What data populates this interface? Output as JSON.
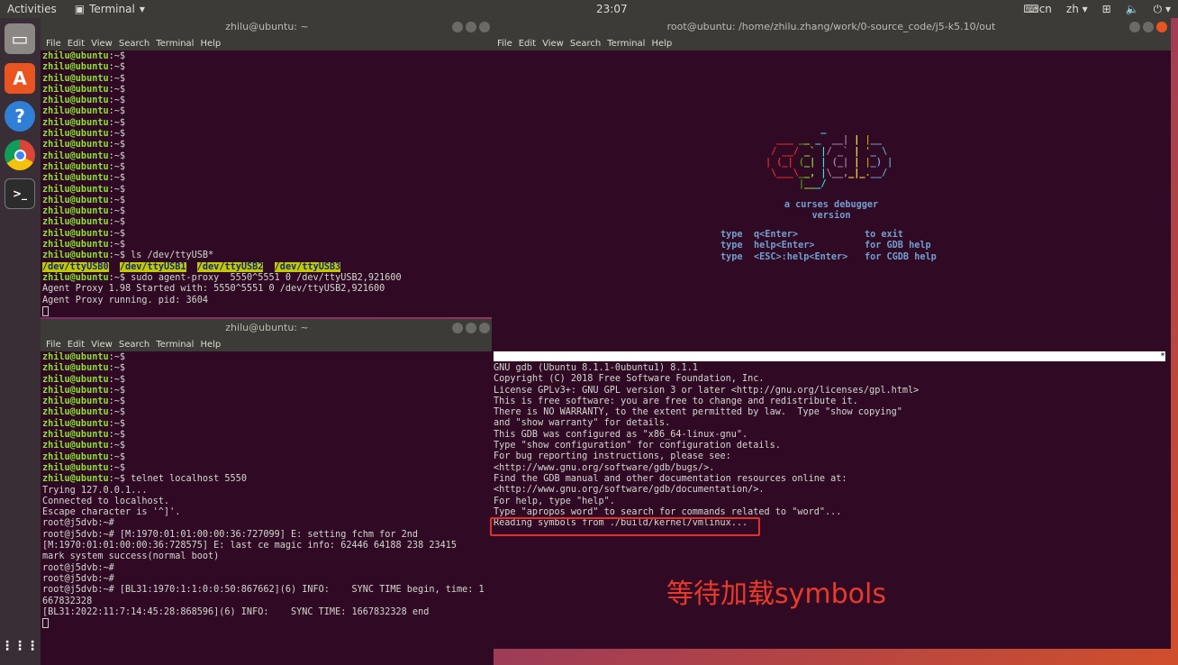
{
  "topbar": {
    "activities": "Activities",
    "app": "Terminal",
    "clock": "23:07",
    "kbd": "cn",
    "lang": "zh"
  },
  "dock": {
    "items": [
      "files",
      "software",
      "help",
      "chrome",
      "terminal"
    ],
    "apps_grid": "show-applications"
  },
  "term1": {
    "title": "zhilu@ubuntu: ~",
    "menu": [
      "File",
      "Edit",
      "View",
      "Search",
      "Terminal",
      "Help"
    ],
    "prompt_user": "zhilu@ubuntu",
    "prompt_rest": ":~$",
    "empty_prompts": 18,
    "cmd1": " ls /dev/ttyUSB*",
    "devs": [
      "/dev/ttyUSB0",
      "/dev/ttyUSB1",
      "/dev/ttyUSB2",
      "/dev/ttyUSB3"
    ],
    "cmd2": " sudo agent-proxy  5550^5551 0 /dev/ttyUSB2,921600",
    "out": [
      "Agent Proxy 1.98 Started with: 5550^5551 0 /dev/ttyUSB2,921600",
      "Agent Proxy running. pid: 3604"
    ]
  },
  "term2": {
    "title": "zhilu@ubuntu: ~",
    "menu": [
      "File",
      "Edit",
      "View",
      "Search",
      "Terminal",
      "Help"
    ],
    "empty_prompts": 11,
    "cmd": " telnet localhost 5550",
    "out": [
      "Trying 127.0.0.1...",
      "Connected to localhost.",
      "Escape character is '^]'.",
      "",
      "root@j5dvb:~#",
      "root@j5dvb:~# [M:1970:01:01:00:00:36:727099] E: setting fchm for 2nd",
      "[M:1970:01:01:00:00:36:728575] E: last ce magic info: 62446 64188 238 23415",
      "mark system success(normal boot)",
      "",
      "root@j5dvb:~#",
      "root@j5dvb:~#",
      "root@j5dvb:~# [BL31:1970:1:1:0:0:50:867662](6) INFO:    SYNC TIME begin, time: 1",
      "667832328",
      "[BL31:2022:11:7:14:45:28:868596](6) INFO:    SYNC TIME: 1667832328 end"
    ]
  },
  "term3": {
    "title": "root@ubuntu: /home/zhilu.zhang/work/0-source_code/j5-k5.10/out",
    "menu": [
      "File",
      "Edit",
      "View",
      "Search",
      "Terminal",
      "Help"
    ],
    "logo": [
      "          _  ",
      "  ___ __ _  __| | |__  ",
      " / __/ _` |/ _` | '_ \\ ",
      "| (_| (_| | (_| | |_) |",
      " \\___\\__, |\\__,_|_.__/ ",
      "      |___/            "
    ],
    "subtitle": "a curses debugger",
    "version": "version",
    "help": [
      [
        "type",
        "q<Enter>",
        "to exit"
      ],
      [
        "type",
        "help<Enter>",
        "for GDB help"
      ],
      [
        "type",
        "<ESC>:help<Enter>",
        "for CGDB help"
      ]
    ],
    "status_marker": "*",
    "gdb": [
      "GNU gdb (Ubuntu 8.1.1-0ubuntu1) 8.1.1",
      "Copyright (C) 2018 Free Software Foundation, Inc.",
      "License GPLv3+: GNU GPL version 3 or later <http://gnu.org/licenses/gpl.html>",
      "This is free software: you are free to change and redistribute it.",
      "There is NO WARRANTY, to the extent permitted by law.  Type \"show copying\"",
      "and \"show warranty\" for details.",
      "This GDB was configured as \"x86_64-linux-gnu\".",
      "Type \"show configuration\" for configuration details.",
      "For bug reporting instructions, please see:",
      "<http://www.gnu.org/software/gdb/bugs/>.",
      "Find the GDB manual and other documentation resources online at:",
      "<http://www.gnu.org/software/gdb/documentation/>.",
      "For help, type \"help\".",
      "Type \"apropos word\" to search for commands related to \"word\"...",
      "Reading symbols from ./build/kernel/vmlinux..."
    ]
  },
  "annotation": "等待加载symbols",
  "colors": {
    "terminal_bg": "#300a24",
    "prompt": "#8ae234",
    "annotation": "#e83a2a",
    "close": "#e95420"
  }
}
